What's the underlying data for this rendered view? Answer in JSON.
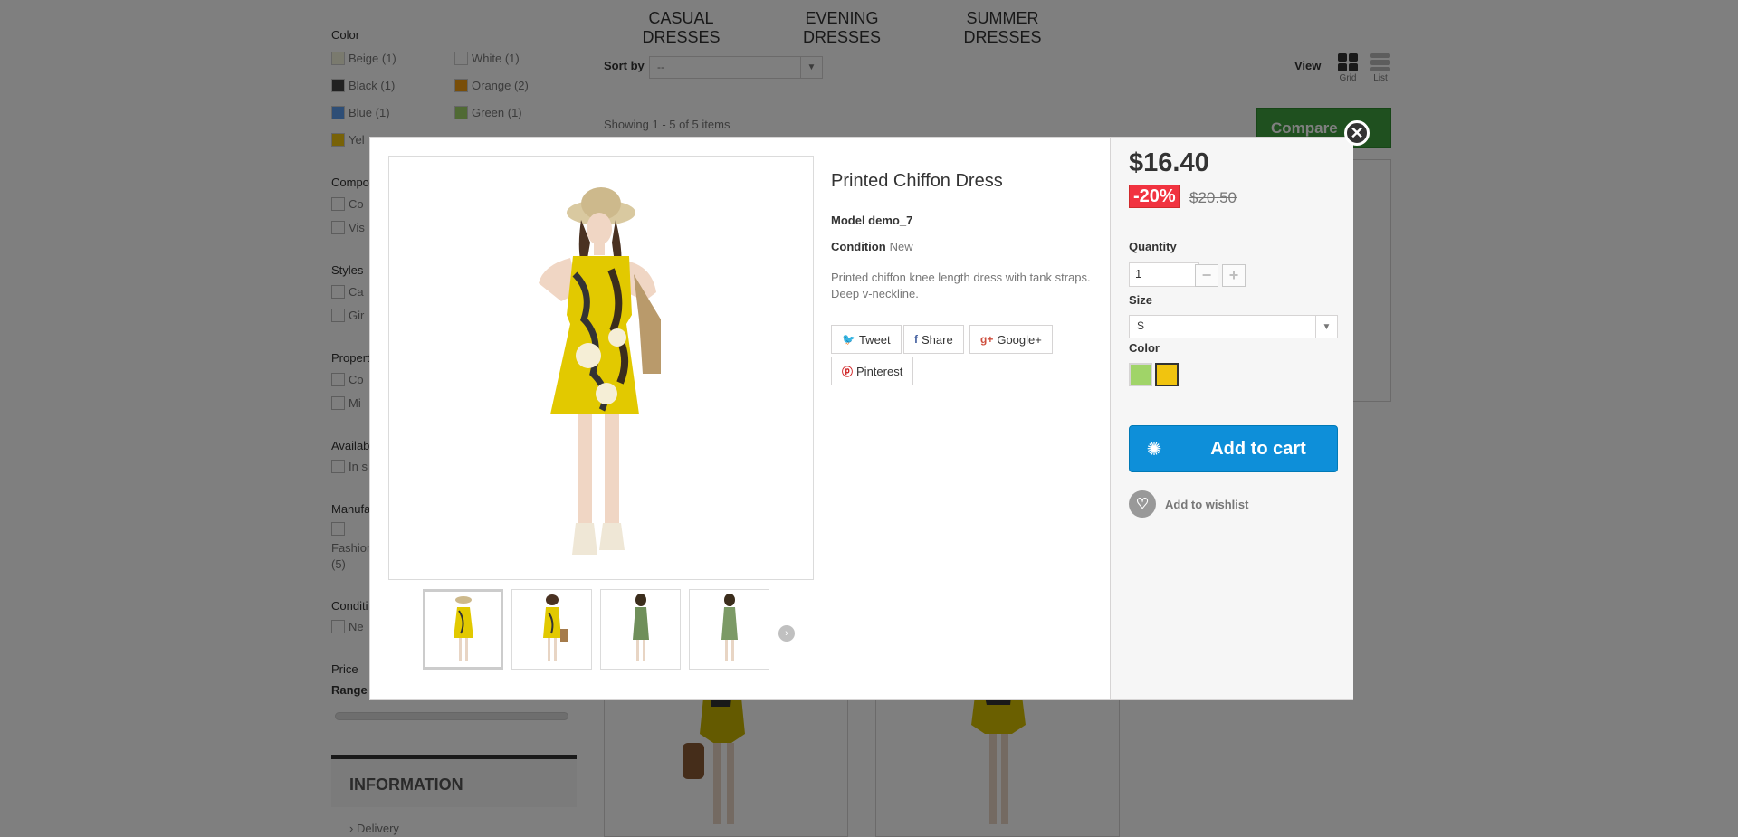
{
  "filters": {
    "color_title": "Color",
    "colors": [
      {
        "label": "Beige (1)",
        "hex": "#f5f5dc"
      },
      {
        "label": "White (1)",
        "hex": "#ffffff"
      },
      {
        "label": "Black (1)",
        "hex": "#434343"
      },
      {
        "label": "Orange (2)",
        "hex": "#f39c11"
      },
      {
        "label": "Blue (1)",
        "hex": "#5d9cec"
      },
      {
        "label": "Green (1)",
        "hex": "#a0d468"
      },
      {
        "label": "Yel",
        "hex": "#f1c40f"
      }
    ],
    "composition_title": "Compo",
    "composition_items": [
      "Co",
      "Vis"
    ],
    "styles_title": "Styles",
    "styles_items": [
      "Ca",
      "Gir"
    ],
    "properties_title": "Propert",
    "properties_items": [
      "Co",
      "Mi"
    ],
    "availability_title": "Availab",
    "availability_items": [
      "In s"
    ],
    "manufacturer_title": "Manufa",
    "manufacturer_item": "Fashion",
    "manufacturer_count": "(5)",
    "condition_title": "Conditi",
    "condition_items": [
      "Ne"
    ],
    "price_title": "Price",
    "range_label": "Range"
  },
  "categories": [
    "CASUAL DRESSES",
    "EVENING DRESSES",
    "SUMMER DRESSES"
  ],
  "toolbar": {
    "sort_label": "Sort by",
    "sort_value": "--",
    "view_label": "View",
    "grid_label": "Grid",
    "list_label": "List",
    "showing": "Showing 1 - 5 of 5 items",
    "compare_label": "Compare"
  },
  "info_block": {
    "title": "INFORMATION",
    "delivery": "Delivery"
  },
  "modal": {
    "product_name": "Printed Chiffon Dress",
    "model_label": "Model demo_7",
    "condition_label": "Condition",
    "condition_value": "New",
    "description": "Printed chiffon knee length dress with tank straps. Deep v-neckline.",
    "social": {
      "tweet": "Tweet",
      "share": "Share",
      "google": "Google+",
      "pinterest": "Pinterest"
    },
    "price": "$16.40",
    "discount": "-20%",
    "old_price": "$20.50",
    "quantity_label": "Quantity",
    "quantity_value": "1",
    "size_label": "Size",
    "size_value": "S",
    "color_label": "Color",
    "color_options": [
      {
        "name": "Green",
        "hex": "#a0d468"
      },
      {
        "name": "Yellow",
        "hex": "#f1c40f"
      }
    ],
    "add_to_cart": "Add to cart",
    "add_to_wishlist": "Add to wishlist"
  },
  "colors": {
    "accent_blue": "#0e8fd9",
    "discount_red": "#f13340",
    "compare_green": "#3ea03e"
  }
}
